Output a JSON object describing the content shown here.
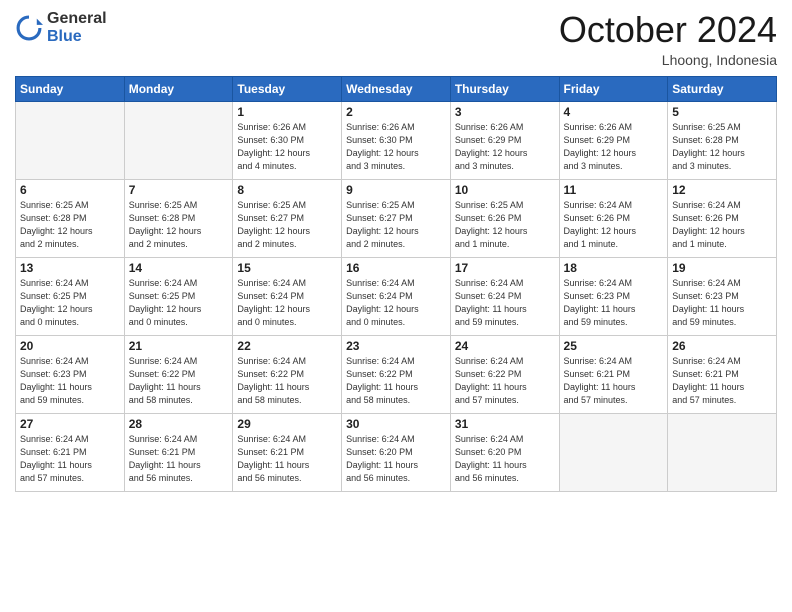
{
  "header": {
    "logo_line1": "General",
    "logo_line2": "Blue",
    "month_title": "October 2024",
    "location": "Lhoong, Indonesia"
  },
  "weekdays": [
    "Sunday",
    "Monday",
    "Tuesday",
    "Wednesday",
    "Thursday",
    "Friday",
    "Saturday"
  ],
  "weeks": [
    [
      {
        "day": "",
        "info": "",
        "empty": true
      },
      {
        "day": "",
        "info": "",
        "empty": true
      },
      {
        "day": "1",
        "info": "Sunrise: 6:26 AM\nSunset: 6:30 PM\nDaylight: 12 hours\nand 4 minutes."
      },
      {
        "day": "2",
        "info": "Sunrise: 6:26 AM\nSunset: 6:30 PM\nDaylight: 12 hours\nand 3 minutes."
      },
      {
        "day": "3",
        "info": "Sunrise: 6:26 AM\nSunset: 6:29 PM\nDaylight: 12 hours\nand 3 minutes."
      },
      {
        "day": "4",
        "info": "Sunrise: 6:26 AM\nSunset: 6:29 PM\nDaylight: 12 hours\nand 3 minutes."
      },
      {
        "day": "5",
        "info": "Sunrise: 6:25 AM\nSunset: 6:28 PM\nDaylight: 12 hours\nand 3 minutes."
      }
    ],
    [
      {
        "day": "6",
        "info": "Sunrise: 6:25 AM\nSunset: 6:28 PM\nDaylight: 12 hours\nand 2 minutes."
      },
      {
        "day": "7",
        "info": "Sunrise: 6:25 AM\nSunset: 6:28 PM\nDaylight: 12 hours\nand 2 minutes."
      },
      {
        "day": "8",
        "info": "Sunrise: 6:25 AM\nSunset: 6:27 PM\nDaylight: 12 hours\nand 2 minutes."
      },
      {
        "day": "9",
        "info": "Sunrise: 6:25 AM\nSunset: 6:27 PM\nDaylight: 12 hours\nand 2 minutes."
      },
      {
        "day": "10",
        "info": "Sunrise: 6:25 AM\nSunset: 6:26 PM\nDaylight: 12 hours\nand 1 minute."
      },
      {
        "day": "11",
        "info": "Sunrise: 6:24 AM\nSunset: 6:26 PM\nDaylight: 12 hours\nand 1 minute."
      },
      {
        "day": "12",
        "info": "Sunrise: 6:24 AM\nSunset: 6:26 PM\nDaylight: 12 hours\nand 1 minute."
      }
    ],
    [
      {
        "day": "13",
        "info": "Sunrise: 6:24 AM\nSunset: 6:25 PM\nDaylight: 12 hours\nand 0 minutes."
      },
      {
        "day": "14",
        "info": "Sunrise: 6:24 AM\nSunset: 6:25 PM\nDaylight: 12 hours\nand 0 minutes."
      },
      {
        "day": "15",
        "info": "Sunrise: 6:24 AM\nSunset: 6:24 PM\nDaylight: 12 hours\nand 0 minutes."
      },
      {
        "day": "16",
        "info": "Sunrise: 6:24 AM\nSunset: 6:24 PM\nDaylight: 12 hours\nand 0 minutes."
      },
      {
        "day": "17",
        "info": "Sunrise: 6:24 AM\nSunset: 6:24 PM\nDaylight: 11 hours\nand 59 minutes."
      },
      {
        "day": "18",
        "info": "Sunrise: 6:24 AM\nSunset: 6:23 PM\nDaylight: 11 hours\nand 59 minutes."
      },
      {
        "day": "19",
        "info": "Sunrise: 6:24 AM\nSunset: 6:23 PM\nDaylight: 11 hours\nand 59 minutes."
      }
    ],
    [
      {
        "day": "20",
        "info": "Sunrise: 6:24 AM\nSunset: 6:23 PM\nDaylight: 11 hours\nand 59 minutes."
      },
      {
        "day": "21",
        "info": "Sunrise: 6:24 AM\nSunset: 6:22 PM\nDaylight: 11 hours\nand 58 minutes."
      },
      {
        "day": "22",
        "info": "Sunrise: 6:24 AM\nSunset: 6:22 PM\nDaylight: 11 hours\nand 58 minutes."
      },
      {
        "day": "23",
        "info": "Sunrise: 6:24 AM\nSunset: 6:22 PM\nDaylight: 11 hours\nand 58 minutes."
      },
      {
        "day": "24",
        "info": "Sunrise: 6:24 AM\nSunset: 6:22 PM\nDaylight: 11 hours\nand 57 minutes."
      },
      {
        "day": "25",
        "info": "Sunrise: 6:24 AM\nSunset: 6:21 PM\nDaylight: 11 hours\nand 57 minutes."
      },
      {
        "day": "26",
        "info": "Sunrise: 6:24 AM\nSunset: 6:21 PM\nDaylight: 11 hours\nand 57 minutes."
      }
    ],
    [
      {
        "day": "27",
        "info": "Sunrise: 6:24 AM\nSunset: 6:21 PM\nDaylight: 11 hours\nand 57 minutes."
      },
      {
        "day": "28",
        "info": "Sunrise: 6:24 AM\nSunset: 6:21 PM\nDaylight: 11 hours\nand 56 minutes."
      },
      {
        "day": "29",
        "info": "Sunrise: 6:24 AM\nSunset: 6:21 PM\nDaylight: 11 hours\nand 56 minutes."
      },
      {
        "day": "30",
        "info": "Sunrise: 6:24 AM\nSunset: 6:20 PM\nDaylight: 11 hours\nand 56 minutes."
      },
      {
        "day": "31",
        "info": "Sunrise: 6:24 AM\nSunset: 6:20 PM\nDaylight: 11 hours\nand 56 minutes."
      },
      {
        "day": "",
        "info": "",
        "empty": true
      },
      {
        "day": "",
        "info": "",
        "empty": true
      }
    ]
  ]
}
